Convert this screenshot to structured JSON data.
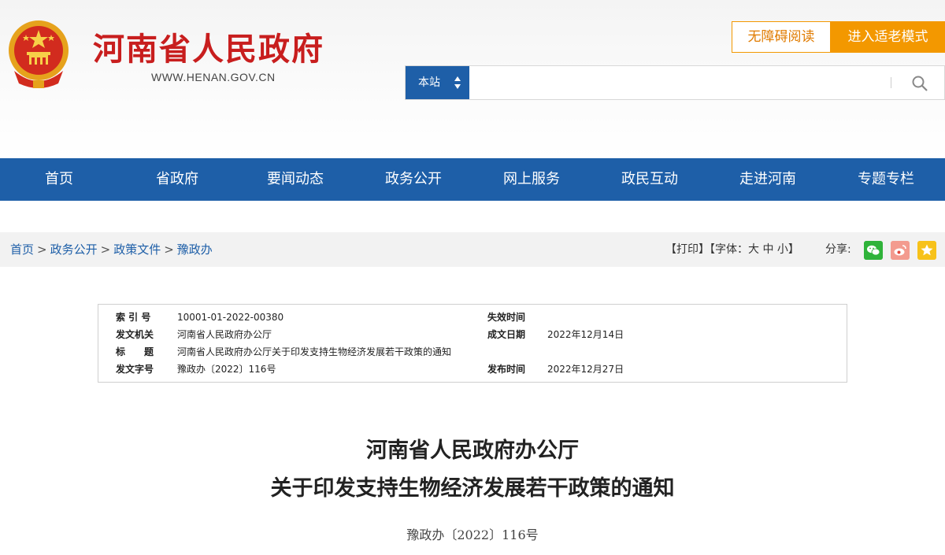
{
  "header": {
    "site_title": "河南省人民政府",
    "site_url": "WWW.HENAN.GOV.CN",
    "accessibility_label": "无障碍阅读",
    "elder_mode_label": "进入适老模式",
    "search": {
      "scope": "本站",
      "placeholder": ""
    }
  },
  "nav": [
    "首页",
    "省政府",
    "要闻动态",
    "政务公开",
    "网上服务",
    "政民互动",
    "走进河南",
    "专题专栏"
  ],
  "breadcrumb": [
    "首页",
    "政务公开",
    "政策文件",
    "豫政办"
  ],
  "tools": {
    "print": "【打印】",
    "font_prefix": "【字体：",
    "font_large": "大",
    "font_medium": "中",
    "font_small": "小",
    "font_suffix": "】",
    "share_label": "分享:"
  },
  "info": {
    "index_label": "索 引 号",
    "index_value": "10001-01-2022-00380",
    "expire_label": "失效时间",
    "expire_value": "",
    "issuer_label": "发文机关",
    "issuer_value": "河南省人民政府办公厅",
    "written_label": "成文日期",
    "written_value": "2022年12月14日",
    "title_label": "标　　题",
    "title_value": "河南省人民政府办公厅关于印发支持生物经济发展若干政策的通知",
    "docno_label": "发文字号",
    "docno_value": "豫政办〔2022〕116号",
    "publish_label": "发布时间",
    "publish_value": "2022年12月27日"
  },
  "document": {
    "title_line1": "河南省人民政府办公厅",
    "title_line2": "关于印发支持生物经济发展若干政策的通知",
    "number": "豫政办〔2022〕116号"
  },
  "colors": {
    "brand_red": "#c81e1e",
    "nav_blue": "#1e5fa8",
    "accent_orange": "#f39800"
  }
}
